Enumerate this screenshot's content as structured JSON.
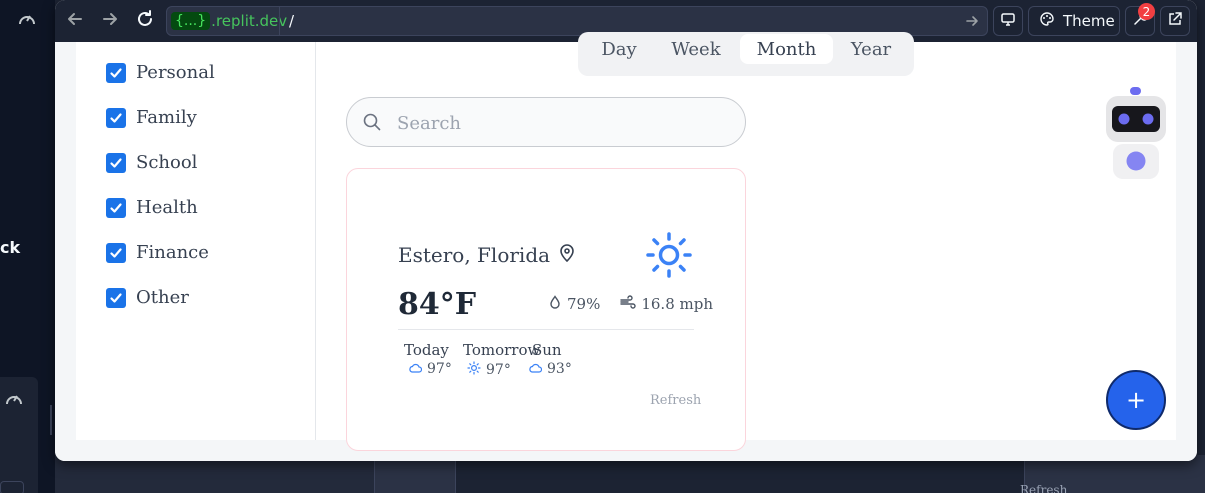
{
  "browser": {
    "url_badge": "{...}",
    "url_domain": ".replit.dev",
    "url_path": "/",
    "theme_label": "Theme",
    "tools_badge_count": "2"
  },
  "sidebar": {
    "categories": [
      {
        "label": "Personal",
        "checked": true
      },
      {
        "label": "Family",
        "checked": true
      },
      {
        "label": "School",
        "checked": true
      },
      {
        "label": "Health",
        "checked": true
      },
      {
        "label": "Finance",
        "checked": true
      },
      {
        "label": "Other",
        "checked": true
      }
    ]
  },
  "view_tabs": {
    "items": [
      "Day",
      "Week",
      "Month",
      "Year"
    ],
    "active": "Month"
  },
  "search": {
    "placeholder": "Search",
    "value": ""
  },
  "weather": {
    "location": "Estero, Florida",
    "temperature": "84°F",
    "humidity": "79%",
    "wind": "16.8 mph",
    "forecast": [
      {
        "day": "Today",
        "icon": "cloud-icon",
        "temp": "97°"
      },
      {
        "day": "Tomorrow",
        "icon": "sun-icon",
        "temp": "97°"
      },
      {
        "day": "Sun",
        "icon": "cloud-icon",
        "temp": "93°"
      }
    ],
    "refresh_label": "Refresh"
  },
  "fab": {
    "label": "+"
  },
  "background": {
    "partial_text": "ck",
    "ghost_refresh": "Refresh"
  },
  "colors": {
    "accent": "#2563eb",
    "checkbox": "#1a73e8",
    "sun": "#3b82f6",
    "url_green": "#46c45d"
  }
}
